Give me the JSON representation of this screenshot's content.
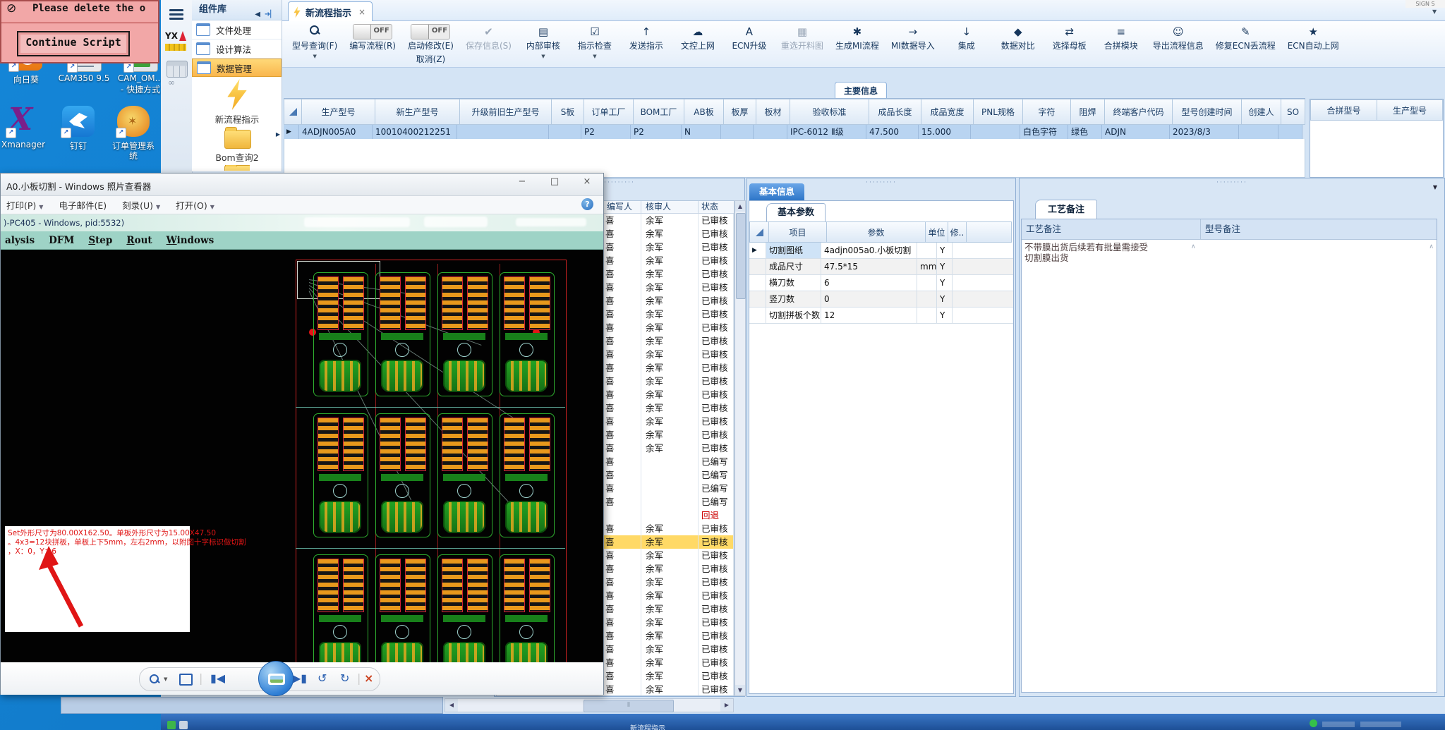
{
  "window": {
    "corner_fragment": "SIGN S"
  },
  "script_dialog": {
    "message": "Please delete the o",
    "button_label": "Continue Script"
  },
  "desktop": {
    "icons": [
      {
        "name": "xiangrikui",
        "label": "向日葵"
      },
      {
        "name": "cam350",
        "label": "CAM350 9.5"
      },
      {
        "name": "cam-om",
        "label": "CAM_OM...",
        "label2": "- 快捷方式"
      },
      {
        "name": "xmanager",
        "label": "Xmanager"
      },
      {
        "name": "dingtalk",
        "label": "钉钉"
      },
      {
        "name": "order-system",
        "label": "订单管理系",
        "label2": "统"
      }
    ]
  },
  "erp": {
    "system_fragment": "系统",
    "component_panel": {
      "title": "组件库",
      "items": [
        "文件处理",
        "设计算法",
        "数据管理"
      ],
      "selected_index": 2,
      "tools": [
        "新流程指示",
        "Bom查询2"
      ]
    },
    "tab": {
      "label": "新流程指示"
    },
    "toolbar": {
      "items": [
        {
          "label": "型号查询(F)",
          "icon": "search",
          "caret": true
        },
        {
          "label": "编写流程(R)",
          "toggle": "OFF"
        },
        {
          "label": "启动修改(E)",
          "toggle": "OFF",
          "sub": "取消(Z)"
        },
        {
          "label": "保存信息(S)",
          "icon": "check",
          "disabled": true
        },
        {
          "label": "内部审核",
          "icon": "printer",
          "caret": true
        },
        {
          "label": "指示检查",
          "icon": "checkbox",
          "caret": true
        },
        {
          "label": "发送指示",
          "icon": "send"
        },
        {
          "label": "文控上网",
          "icon": "cloud"
        },
        {
          "label": "ECN升级",
          "icon": "letterA"
        },
        {
          "label": "重选开料图",
          "icon": "image",
          "disabled": true
        },
        {
          "label": "生成MI流程",
          "icon": "gears"
        },
        {
          "label": "MI数据导入",
          "icon": "import"
        },
        {
          "label": "集成",
          "icon": "integrate"
        },
        {
          "label": "数据对比",
          "icon": "compare"
        },
        {
          "label": "选择母板",
          "icon": "swap"
        },
        {
          "label": "合拼模块",
          "icon": "module"
        },
        {
          "label": "导出流程信息",
          "icon": "smiley"
        },
        {
          "label": "修复ECN丢流程",
          "icon": "repair"
        },
        {
          "label": "ECN自动上网",
          "icon": "star"
        }
      ]
    },
    "section_tab": "主要信息",
    "main_table": {
      "columns": [
        "生产型号",
        "新生产型号",
        "升级前旧生产型号",
        "S板",
        "订单工厂",
        "BOM工厂",
        "AB板",
        "板厚",
        "板材",
        "验收标准",
        "成品长度",
        "成品宽度",
        "PNL规格",
        "字符",
        "阻焊",
        "终端客户代码",
        "型号创建时间",
        "创建人",
        "SO"
      ],
      "widths": [
        104,
        120,
        130,
        46,
        70,
        72,
        56,
        46,
        48,
        112,
        74,
        74,
        70,
        68,
        48,
        96,
        98,
        56,
        34
      ],
      "values": [
        "4ADJN005A0",
        "10010400212251",
        "",
        "",
        "P2",
        "P2",
        "N",
        "",
        "",
        "IPC-6012 Ⅱ级",
        "47.500",
        "15.000",
        "",
        "白色字符",
        "绿色",
        "ADJN",
        "2023/8/3",
        "",
        ""
      ]
    },
    "merge_table": {
      "columns": [
        "合拼型号",
        "生产型号"
      ]
    },
    "flow_table": {
      "columns": [
        "编写人",
        "核审人",
        "状态"
      ],
      "rows": [
        [
          "喜",
          "余军",
          "已审核",
          ""
        ],
        [
          "喜",
          "余军",
          "已审核",
          ""
        ],
        [
          "喜",
          "余军",
          "已审核",
          ""
        ],
        [
          "喜",
          "余军",
          "已审核",
          ""
        ],
        [
          "喜",
          "余军",
          "已审核",
          ""
        ],
        [
          "喜",
          "余军",
          "已审核",
          ""
        ],
        [
          "喜",
          "余军",
          "已审核",
          ""
        ],
        [
          "喜",
          "余军",
          "已审核",
          ""
        ],
        [
          "喜",
          "余军",
          "已审核",
          ""
        ],
        [
          "喜",
          "余军",
          "已审核",
          ""
        ],
        [
          "喜",
          "余军",
          "已审核",
          ""
        ],
        [
          "喜",
          "余军",
          "已审核",
          ""
        ],
        [
          "喜",
          "余军",
          "已审核",
          ""
        ],
        [
          "喜",
          "余军",
          "已审核",
          ""
        ],
        [
          "喜",
          "余军",
          "已审核",
          ""
        ],
        [
          "喜",
          "余军",
          "已审核",
          ""
        ],
        [
          "喜",
          "余军",
          "已审核",
          ""
        ],
        [
          "喜",
          "余军",
          "已审核",
          ""
        ],
        [
          "喜",
          "",
          "已编写",
          ""
        ],
        [
          "喜",
          "",
          "已编写",
          ""
        ],
        [
          "喜",
          "",
          "已编写",
          ""
        ],
        [
          "喜",
          "",
          "已编写",
          ""
        ],
        [
          "",
          "",
          "回退",
          "red"
        ],
        [
          "喜",
          "余军",
          "已审核",
          ""
        ],
        [
          "喜",
          "余军",
          "已审核",
          "hl"
        ],
        [
          "喜",
          "余军",
          "已审核",
          ""
        ],
        [
          "喜",
          "余军",
          "已审核",
          ""
        ],
        [
          "喜",
          "余军",
          "已审核",
          ""
        ],
        [
          "喜",
          "余军",
          "已审核",
          ""
        ],
        [
          "喜",
          "余军",
          "已审核",
          ""
        ],
        [
          "喜",
          "余军",
          "已审核",
          ""
        ],
        [
          "喜",
          "余军",
          "已审核",
          ""
        ],
        [
          "喜",
          "余军",
          "已审核",
          ""
        ],
        [
          "喜",
          "余军",
          "已审核",
          ""
        ],
        [
          "喜",
          "余军",
          "已审核",
          ""
        ],
        [
          "喜",
          "余军",
          "已审核",
          ""
        ]
      ]
    },
    "info_panel": {
      "tab": "基本信息",
      "subtab": "基本参数",
      "columns": [
        "项目",
        "参数",
        "单位",
        "修.."
      ],
      "rows": [
        {
          "item": "切割图纸",
          "value": "4adjn005a0.小板切割",
          "unit": "",
          "flag": "Y"
        },
        {
          "item": "成品尺寸",
          "value": "47.5*15",
          "unit": "mm",
          "flag": "Y"
        },
        {
          "item": "横刀数",
          "value": "6",
          "unit": "",
          "flag": "Y"
        },
        {
          "item": "竖刀数",
          "value": "0",
          "unit": "",
          "flag": "Y"
        },
        {
          "item": "切割拼板个数",
          "value": "12",
          "unit": "",
          "flag": "Y"
        }
      ]
    },
    "notes_panel": {
      "tab": "工艺备注",
      "col1": "工艺备注",
      "col2": "型号备注",
      "note_line1": "不带膜出货后续若有批量需接受",
      "note_line2": "切割膜出货"
    },
    "status_fragment": "新流程指示"
  },
  "photo_viewer": {
    "title": "A0.小板切割 - Windows 照片查看器",
    "menu": [
      {
        "label": "打印(P)",
        "caret": true
      },
      {
        "label": "电子邮件(E)",
        "caret": false
      },
      {
        "label": "刻录(U)",
        "caret": true
      },
      {
        "label": "打开(O)",
        "caret": true
      }
    ],
    "cam": {
      "caption": ")-PC405 - Windows, pid:5532)",
      "menu": [
        {
          "label": "alysis",
          "u": false
        },
        {
          "label": "DFM",
          "u": false
        },
        {
          "label": "Step",
          "u": true
        },
        {
          "label": "Rout",
          "u": true
        },
        {
          "label": "Windows",
          "u": true
        }
      ],
      "annotation_lines": [
        "Set外形尺寸为80.00X162.50。单板外形尺寸为15.00X47.50",
        "。4x3=12块拼板，单板上下5mm，左右2mm，以附图十字标识做切割",
        "，X：0，Y：6"
      ],
      "colors": {
        "board_green": "#1d9a1d",
        "pad_orange": "#e8991c",
        "outline_red": "#cc2222",
        "canvas": "#000000",
        "teal": "#9ed3c6"
      }
    }
  },
  "colors": {
    "accent_blue": "#2a6fc0",
    "selected_row": "#b9d4f1",
    "highlight_row": "#ffd966",
    "status_red": "#cc0000",
    "panel_bg": "#dce9f7"
  }
}
